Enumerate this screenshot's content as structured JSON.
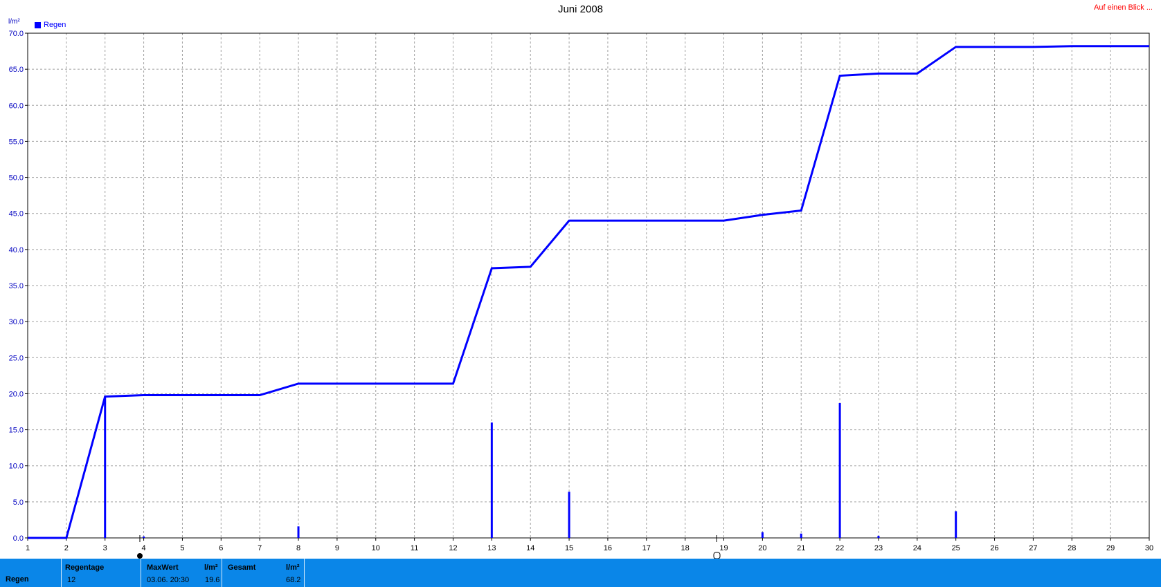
{
  "title": "Juni 2008",
  "top_link": "Auf einen Blick ...",
  "unit_label": "l/m²",
  "legend": {
    "label": "Regen",
    "color": "#0000ff"
  },
  "colors": {
    "series": "#0000ff",
    "footer_bg": "#0a86e8",
    "link": "#ff0000",
    "grid": "#a0a0a0"
  },
  "chart_data": {
    "type": "line",
    "title": "Juni 2008",
    "ylabel": "l/m²",
    "xlim": [
      1,
      30
    ],
    "ylim": [
      0,
      70
    ],
    "x_ticks": [
      1,
      2,
      3,
      4,
      5,
      6,
      7,
      8,
      9,
      10,
      11,
      12,
      13,
      14,
      15,
      16,
      17,
      18,
      19,
      20,
      21,
      22,
      23,
      24,
      25,
      26,
      27,
      28,
      29,
      30
    ],
    "y_ticks": [
      "0.0",
      "5.0",
      "10.0",
      "15.0",
      "20.0",
      "25.0",
      "30.0",
      "35.0",
      "40.0",
      "45.0",
      "50.0",
      "55.0",
      "60.0",
      "65.0",
      "70.0"
    ],
    "grid": true,
    "legend_position": "top-left",
    "series": [
      {
        "name": "Regen",
        "kind": "line",
        "points": [
          [
            1,
            0
          ],
          [
            2,
            0
          ],
          [
            3,
            19.6
          ],
          [
            4,
            19.8
          ],
          [
            5,
            19.8
          ],
          [
            6,
            19.8
          ],
          [
            7,
            19.8
          ],
          [
            8,
            21.4
          ],
          [
            9,
            21.4
          ],
          [
            10,
            21.4
          ],
          [
            11,
            21.4
          ],
          [
            12,
            21.4
          ],
          [
            13,
            37.4
          ],
          [
            14,
            37.6
          ],
          [
            15,
            44.0
          ],
          [
            16,
            44.0
          ],
          [
            17,
            44.0
          ],
          [
            18,
            44.0
          ],
          [
            19,
            44.0
          ],
          [
            20,
            44.8
          ],
          [
            21,
            45.4
          ],
          [
            22,
            64.1
          ],
          [
            23,
            64.4
          ],
          [
            24,
            64.4
          ],
          [
            25,
            68.1
          ],
          [
            26,
            68.1
          ],
          [
            27,
            68.1
          ],
          [
            28,
            68.2
          ],
          [
            29,
            68.2
          ],
          [
            30,
            68.2
          ]
        ]
      },
      {
        "name": "Regen",
        "kind": "bar",
        "points": [
          [
            3,
            19.6
          ],
          [
            4,
            0.2
          ],
          [
            8,
            1.6
          ],
          [
            13,
            16.0
          ],
          [
            15,
            6.4
          ],
          [
            20,
            0.8
          ],
          [
            21,
            0.6
          ],
          [
            22,
            18.7
          ],
          [
            23,
            0.3
          ],
          [
            25,
            3.7
          ]
        ]
      }
    ]
  },
  "footer": {
    "row_label": "Regen",
    "regentage": {
      "label": "Regentage",
      "value": "12"
    },
    "maxwert": {
      "label": "MaxWert",
      "unit": "l/m²",
      "datetime": "03.06.  20:30",
      "value": "19.6"
    },
    "gesamt": {
      "label": "Gesamt",
      "unit": "l/m²",
      "value": "68.2"
    }
  }
}
